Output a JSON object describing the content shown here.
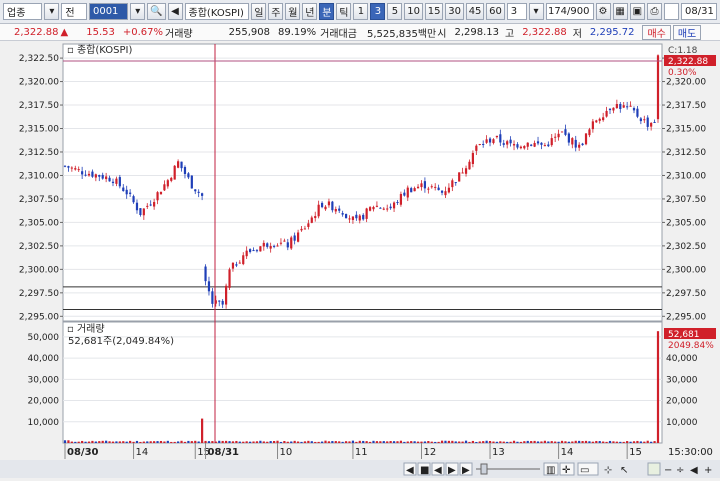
{
  "toolbar": {
    "market_select": "업종",
    "type_select": "전",
    "code": "0001",
    "index_name": "종합(KOSPI)",
    "period_tabs": [
      "일",
      "주",
      "월",
      "년",
      "분",
      "틱"
    ],
    "active_period": "분",
    "interval_buttons": [
      "1",
      "3",
      "5",
      "10",
      "15",
      "30",
      "45",
      "60"
    ],
    "active_interval": "3",
    "interval_value": "3",
    "count": "174/900",
    "date": "08/31"
  },
  "infobar": {
    "price": "2,322.88",
    "change": "15.53",
    "change_pct": "+0.67%",
    "volume_label": "거래량",
    "volume": "255,908",
    "volume_ratio": "89.19%",
    "amount_label": "거래대금",
    "amount": "5,525,835백만",
    "open_label": "시",
    "open": "2,298.13",
    "high_label": "고",
    "high": "2,322.88",
    "low_label": "저",
    "low": "2,295.72",
    "buy_label": "매수",
    "sell_label": "매도"
  },
  "price_panel": {
    "title": "종합(KOSPI)",
    "indicator": "C:1.18",
    "last_price": "2,322.88",
    "last_change": "0.30%"
  },
  "volume_panel": {
    "title": "거래량",
    "current": "52,681주(2,049.84%)",
    "last_volume": "52,681",
    "last_ratio": "2049.84%"
  },
  "time_axis": {
    "labels": [
      "08/30",
      "14",
      "15",
      "08/31",
      "10",
      "11",
      "12",
      "13",
      "14",
      "15"
    ],
    "clock": "15:30:00"
  },
  "colors": {
    "up": "#d0202a",
    "down": "#1f3fb8",
    "crosshair": "#c02040"
  },
  "chart_data": [
    {
      "type": "candlestick",
      "title": "종합(KOSPI)",
      "ylim": [
        2294.5,
        2324
      ],
      "yticks": [
        "2,322.50",
        "2,320.00",
        "2,317.50",
        "2,315.00",
        "2,312.50",
        "2,310.00",
        "2,307.50",
        "2,305.00",
        "2,302.50",
        "2,300.00",
        "2,297.50",
        "2,295.00"
      ],
      "anchor_closes": [
        [
          0,
          2311.0
        ],
        [
          5,
          2310.4
        ],
        [
          10,
          2310.0
        ],
        [
          14,
          2309.6
        ],
        [
          18,
          2308.2
        ],
        [
          22,
          2306.0
        ],
        [
          26,
          2307.6
        ],
        [
          30,
          2309.5
        ],
        [
          33,
          2311.4
        ],
        [
          37,
          2309.0
        ],
        [
          40,
          2307.8
        ],
        [
          41,
          2298.6
        ],
        [
          43,
          2296.4
        ],
        [
          46,
          2296.2
        ],
        [
          48,
          2299.8
        ],
        [
          52,
          2301.6
        ],
        [
          56,
          2302.3
        ],
        [
          60,
          2302.9
        ],
        [
          65,
          2302.6
        ],
        [
          70,
          2304.5
        ],
        [
          75,
          2307.0
        ],
        [
          80,
          2306.5
        ],
        [
          85,
          2305.0
        ],
        [
          90,
          2306.8
        ],
        [
          95,
          2306.5
        ],
        [
          100,
          2308.5
        ],
        [
          105,
          2309.0
        ],
        [
          110,
          2308.2
        ],
        [
          115,
          2310.0
        ],
        [
          120,
          2313.0
        ],
        [
          125,
          2314.0
        ],
        [
          130,
          2313.2
        ],
        [
          135,
          2313.5
        ],
        [
          140,
          2313.2
        ],
        [
          145,
          2314.5
        ],
        [
          150,
          2313.0
        ],
        [
          155,
          2316.0
        ],
        [
          160,
          2317.6
        ],
        [
          165,
          2317.0
        ],
        [
          170,
          2315.5
        ],
        [
          173,
          2316.0
        ]
      ],
      "last_candle": {
        "open": 2316.0,
        "high": 2322.9,
        "low": 2315.6,
        "close": 2322.8
      },
      "horizontal_lines": [
        2298.13,
        2295.72
      ]
    },
    {
      "type": "bar",
      "title": "거래량",
      "ylim": [
        0,
        57000
      ],
      "yticks": [
        "50,000",
        "40,000",
        "30,000",
        "20,000",
        "10,000"
      ],
      "spike_1": {
        "index": 40,
        "value": 11500
      },
      "spike_2": {
        "index": 173,
        "value": 52681
      },
      "typical_value": 800
    }
  ]
}
